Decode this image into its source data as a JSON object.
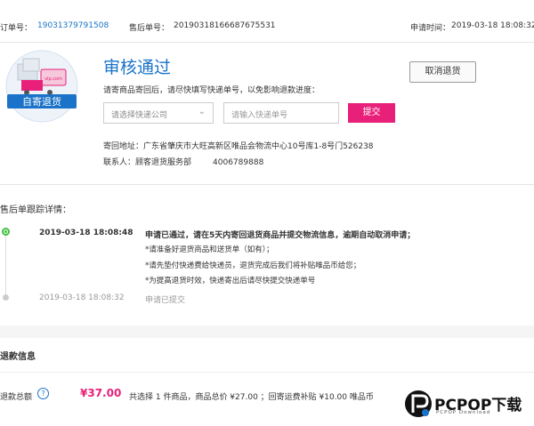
{
  "header": {
    "order_label": "订单号：",
    "order_no": "19031379791508",
    "aftersale_label": "售后单号：",
    "aftersale_no": "20190318166687675531",
    "apply_time_label": "申请时间：",
    "apply_time": "2019-03-18 18:08:32"
  },
  "badge": {
    "text": "自寄退货",
    "box_text": "vip.com"
  },
  "status": {
    "title": "审核通过",
    "hint": "请寄商品寄回后，请尽快填写快递单号，以免影响退款进度：",
    "courier_placeholder": "请选择快递公司",
    "tracking_placeholder": "请输入快递单号",
    "submit_label": "提交",
    "cancel_label": "取消退货",
    "address_label": "寄回地址：",
    "address": "广东省肇庆市大旺高新区唯品会物流中心10号库1-8号门526238",
    "contact_label": "联系人：",
    "contact_name": "顾客退货服务部",
    "contact_phone": "4006789888"
  },
  "tracking": {
    "title": "售后单跟踪详情：",
    "events": [
      {
        "time": "2019-03-18 18:08:48",
        "message": "申请已通过，请在5天内寄回退货商品并提交物流信息，逾期自动取消申请；",
        "notes": [
          "*请准备好退货商品和送货单（如有）；",
          "*请先垫付快递费给快递员，退货完成后我们将补贴唯品币给您；",
          "*为提高退货时效，快递寄出后请尽快提交快递单号"
        ]
      },
      {
        "time": "2019-03-18 18:08:32",
        "message": "申请已提交",
        "notes": []
      }
    ]
  },
  "refund": {
    "title": "退款信息",
    "total_label": "退款总额",
    "help_icon": "?",
    "amount": "¥37.00",
    "summary": "共选择  1 件商品，商品总价  ¥27.00  ；回寄运费补贴  ¥10.00 唯品币"
  },
  "watermark": {
    "brand": "PCPOP下载",
    "sub": "PCPOP Download"
  },
  "colors": {
    "accent_blue": "#1a73c8",
    "accent_pink": "#e8207a",
    "status_green": "#3fbf3f"
  }
}
